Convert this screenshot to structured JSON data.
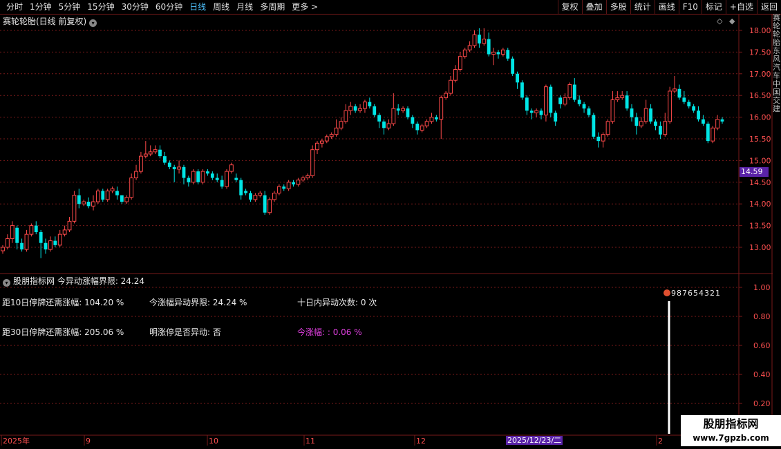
{
  "toolbar": {
    "periods": [
      "分时",
      "1分钟",
      "5分钟",
      "15分钟",
      "30分钟",
      "60分钟",
      "日线",
      "周线",
      "月线",
      "多周期",
      "更多 >"
    ],
    "active_period": "日线",
    "actions": [
      "复权",
      "叠加",
      "多股",
      "统计",
      "画线",
      "F10",
      "标记",
      "+自选",
      "返回"
    ]
  },
  "chart_title": "赛轮轮胎(日线 前复权)",
  "current_price_tag": "14.59",
  "y_axis_ticks": [
    "18.00",
    "17.50",
    "17.00",
    "16.50",
    "16.00",
    "15.50",
    "15.00",
    "14.50",
    "14.00",
    "13.50",
    "13.00"
  ],
  "indicator": {
    "title": "股朋指标网 今异动涨幅界限: 24.24",
    "row1": [
      "距10日停牌还需涨幅: 104.20 %",
      "今涨幅异动界限: 24.24 %",
      "十日内异动次数: 0 次"
    ],
    "row2": [
      "距30日停牌还需涨幅: 205.06 %",
      "明涨停是否异动: 否",
      "今涨幅: : 0.06 %"
    ],
    "y_ticks": [
      "1.00",
      "0.80",
      "0.60",
      "0.40",
      "0.20"
    ],
    "marker_digits": "987654321"
  },
  "x_axis": {
    "labels": [
      "2025年",
      "9",
      "10",
      "11",
      "12",
      "2"
    ],
    "highlight_date": "2025/12/23/二"
  },
  "watermark": {
    "line1": "股朋指标网",
    "line2": "www.7gpzb.com"
  },
  "right_strip_text": "赛轮轮胎东风汽车中国交建",
  "colors": {
    "up": "#ff4a4a",
    "down": "#00e5e5",
    "grid": "#7a1a1a",
    "accent_purple": "#5a23a8",
    "indicator_magenta": "#e040e0"
  },
  "chart_data": {
    "type": "candlestick",
    "ylim": [
      12.4,
      18.15
    ],
    "candles": [
      [
        12.92,
        13.0,
        12.85,
        13.05
      ],
      [
        13.0,
        13.2,
        12.95,
        13.3
      ],
      [
        13.2,
        13.5,
        13.1,
        13.6
      ],
      [
        13.45,
        13.1,
        12.95,
        13.5
      ],
      [
        13.1,
        12.95,
        12.9,
        13.2
      ],
      [
        12.95,
        13.3,
        12.9,
        13.4
      ],
      [
        13.3,
        13.5,
        13.25,
        13.55
      ],
      [
        13.5,
        13.35,
        13.3,
        13.6
      ],
      [
        13.35,
        13.1,
        12.75,
        13.4
      ],
      [
        13.1,
        12.95,
        12.85,
        13.2
      ],
      [
        12.95,
        13.15,
        12.9,
        13.25
      ],
      [
        13.15,
        13.05,
        13.0,
        13.25
      ],
      [
        13.05,
        13.3,
        13.0,
        13.4
      ],
      [
        13.3,
        13.4,
        13.25,
        13.5
      ],
      [
        13.4,
        13.6,
        13.35,
        13.7
      ],
      [
        13.6,
        14.2,
        13.55,
        14.3
      ],
      [
        14.2,
        14.0,
        13.9,
        14.35
      ],
      [
        14.0,
        14.05,
        13.95,
        14.1
      ],
      [
        14.05,
        13.95,
        13.9,
        14.15
      ],
      [
        13.95,
        14.05,
        13.85,
        14.2
      ],
      [
        14.05,
        14.3,
        14.0,
        14.35
      ],
      [
        14.3,
        14.1,
        14.05,
        14.35
      ],
      [
        14.1,
        14.3,
        14.05,
        14.35
      ],
      [
        14.3,
        14.35,
        14.25,
        14.4
      ],
      [
        14.3,
        14.2,
        14.1,
        14.4
      ],
      [
        14.2,
        14.05,
        14.0,
        14.2
      ],
      [
        14.05,
        14.15,
        14.0,
        14.2
      ],
      [
        14.15,
        14.6,
        14.1,
        14.7
      ],
      [
        14.6,
        14.75,
        14.55,
        14.9
      ],
      [
        14.75,
        15.1,
        14.7,
        15.2
      ],
      [
        15.1,
        15.15,
        15.05,
        15.45
      ],
      [
        15.15,
        15.2,
        15.1,
        15.35
      ],
      [
        15.2,
        15.25,
        15.15,
        15.35
      ],
      [
        15.25,
        15.1,
        15.05,
        15.35
      ],
      [
        15.1,
        14.95,
        14.9,
        15.2
      ],
      [
        14.95,
        14.85,
        14.8,
        15.0
      ],
      [
        14.85,
        14.8,
        14.5,
        14.9
      ],
      [
        14.8,
        14.85,
        14.7,
        15.0
      ],
      [
        14.85,
        14.6,
        14.45,
        14.9
      ],
      [
        14.6,
        14.5,
        14.4,
        14.65
      ],
      [
        14.5,
        14.75,
        14.45,
        14.8
      ],
      [
        14.75,
        14.5,
        14.45,
        14.8
      ],
      [
        14.5,
        14.75,
        14.45,
        14.8
      ],
      [
        14.75,
        14.7,
        14.65,
        14.8
      ],
      [
        14.7,
        14.6,
        14.55,
        14.75
      ],
      [
        14.6,
        14.55,
        14.5,
        14.7
      ],
      [
        14.55,
        14.4,
        14.35,
        14.65
      ],
      [
        14.4,
        14.75,
        14.35,
        14.8
      ],
      [
        14.75,
        14.9,
        14.7,
        14.95
      ],
      [
        14.6,
        14.55,
        14.5,
        14.7
      ],
      [
        14.55,
        14.2,
        14.1,
        14.6
      ],
      [
        14.3,
        14.25,
        14.2,
        14.35
      ],
      [
        14.25,
        14.1,
        14.05,
        14.3
      ],
      [
        14.1,
        14.2,
        14.05,
        14.25
      ],
      [
        14.2,
        14.25,
        14.15,
        14.3
      ],
      [
        14.2,
        13.8,
        13.75,
        14.3
      ],
      [
        13.8,
        14.1,
        13.75,
        14.15
      ],
      [
        14.1,
        14.25,
        14.05,
        14.3
      ],
      [
        14.25,
        14.4,
        14.2,
        14.45
      ],
      [
        14.4,
        14.35,
        14.3,
        14.45
      ],
      [
        14.35,
        14.5,
        14.3,
        14.55
      ],
      [
        14.5,
        14.45,
        14.4,
        14.55
      ],
      [
        14.45,
        14.55,
        14.4,
        14.6
      ],
      [
        14.55,
        14.6,
        14.5,
        14.65
      ],
      [
        14.6,
        14.65,
        14.55,
        14.7
      ],
      [
        14.65,
        15.25,
        14.6,
        15.35
      ],
      [
        15.25,
        15.4,
        15.15,
        15.45
      ],
      [
        15.4,
        15.45,
        15.3,
        15.5
      ],
      [
        15.45,
        15.55,
        15.4,
        15.6
      ],
      [
        15.55,
        15.6,
        15.5,
        15.65
      ],
      [
        15.6,
        15.75,
        15.55,
        15.95
      ],
      [
        15.75,
        15.9,
        15.7,
        16.0
      ],
      [
        15.9,
        16.15,
        15.85,
        16.3
      ],
      [
        16.15,
        16.25,
        16.05,
        16.35
      ],
      [
        16.25,
        16.15,
        16.1,
        16.3
      ],
      [
        16.15,
        16.2,
        16.1,
        16.3
      ],
      [
        16.2,
        16.35,
        16.1,
        16.4
      ],
      [
        16.35,
        16.25,
        16.2,
        16.45
      ],
      [
        16.25,
        16.05,
        16.0,
        16.3
      ],
      [
        16.05,
        15.9,
        15.75,
        16.1
      ],
      [
        15.9,
        15.75,
        15.6,
        15.95
      ],
      [
        15.75,
        15.85,
        15.7,
        15.95
      ],
      [
        15.85,
        16.2,
        15.8,
        16.55
      ],
      [
        16.2,
        16.15,
        16.05,
        16.3
      ],
      [
        16.15,
        16.2,
        16.1,
        16.25
      ],
      [
        16.2,
        16.0,
        15.95,
        16.25
      ],
      [
        16.0,
        15.85,
        15.75,
        16.05
      ],
      [
        15.85,
        15.7,
        15.6,
        15.9
      ],
      [
        15.7,
        15.8,
        15.65,
        15.85
      ],
      [
        15.8,
        15.9,
        15.75,
        15.95
      ],
      [
        15.9,
        16.0,
        15.85,
        16.1
      ],
      [
        16.0,
        15.95,
        15.9,
        16.05
      ],
      [
        15.95,
        16.45,
        15.5,
        16.5
      ],
      [
        16.45,
        16.55,
        16.4,
        16.6
      ],
      [
        16.55,
        16.85,
        16.5,
        16.95
      ],
      [
        16.85,
        17.1,
        16.8,
        17.2
      ],
      [
        17.1,
        17.4,
        17.05,
        17.5
      ],
      [
        17.4,
        17.55,
        17.35,
        17.6
      ],
      [
        17.55,
        17.65,
        17.5,
        17.75
      ],
      [
        17.65,
        17.9,
        17.6,
        18.0
      ],
      [
        17.9,
        17.7,
        17.6,
        18.05
      ],
      [
        17.7,
        17.8,
        17.65,
        18.05
      ],
      [
        17.8,
        17.45,
        17.4,
        17.95
      ],
      [
        17.45,
        17.5,
        17.2,
        17.6
      ],
      [
        17.5,
        17.45,
        17.35,
        17.55
      ],
      [
        17.45,
        17.55,
        17.4,
        17.6
      ],
      [
        17.55,
        17.35,
        17.3,
        17.6
      ],
      [
        17.35,
        17.0,
        16.95,
        17.4
      ],
      [
        17.0,
        16.8,
        16.65,
        17.05
      ],
      [
        16.8,
        16.45,
        16.4,
        16.85
      ],
      [
        16.45,
        16.15,
        16.05,
        16.5
      ],
      [
        16.15,
        16.1,
        15.95,
        16.2
      ],
      [
        16.1,
        16.15,
        16.0,
        16.2
      ],
      [
        16.15,
        16.05,
        15.95,
        16.2
      ],
      [
        16.05,
        16.7,
        15.9,
        16.75
      ],
      [
        16.7,
        16.1,
        16.0,
        16.75
      ],
      [
        16.1,
        15.9,
        15.8,
        16.15
      ],
      [
        16.45,
        16.3,
        16.2,
        16.5
      ],
      [
        16.3,
        16.45,
        16.25,
        16.55
      ],
      [
        16.45,
        16.75,
        16.4,
        16.8
      ],
      [
        16.75,
        16.4,
        16.35,
        16.9
      ],
      [
        16.4,
        16.3,
        16.25,
        16.5
      ],
      [
        16.3,
        16.2,
        16.1,
        16.35
      ],
      [
        16.2,
        16.05,
        16.0,
        16.25
      ],
      [
        16.05,
        15.55,
        15.5,
        16.1
      ],
      [
        15.55,
        15.45,
        15.3,
        15.65
      ],
      [
        15.45,
        15.6,
        15.3,
        15.65
      ],
      [
        15.6,
        15.9,
        15.55,
        15.95
      ],
      [
        15.9,
        16.4,
        15.85,
        16.6
      ],
      [
        16.4,
        16.45,
        16.35,
        16.6
      ],
      [
        16.45,
        16.5,
        16.4,
        16.6
      ],
      [
        16.5,
        16.2,
        16.15,
        16.6
      ],
      [
        16.2,
        16.0,
        15.9,
        16.3
      ],
      [
        16.0,
        15.8,
        15.6,
        16.1
      ],
      [
        15.8,
        15.9,
        15.75,
        16.0
      ],
      [
        15.9,
        16.2,
        15.85,
        16.4
      ],
      [
        16.2,
        15.9,
        15.85,
        16.3
      ],
      [
        15.9,
        15.8,
        15.7,
        15.95
      ],
      [
        15.8,
        15.6,
        15.5,
        15.9
      ],
      [
        15.6,
        15.9,
        15.55,
        16.1
      ],
      [
        15.9,
        16.6,
        15.85,
        16.7
      ],
      [
        16.6,
        16.65,
        16.55,
        16.95
      ],
      [
        16.65,
        16.45,
        16.4,
        16.75
      ],
      [
        16.45,
        16.35,
        16.3,
        16.6
      ],
      [
        16.35,
        16.25,
        16.2,
        16.4
      ],
      [
        16.25,
        16.15,
        16.1,
        16.3
      ],
      [
        16.15,
        15.95,
        15.9,
        16.25
      ],
      [
        15.95,
        15.85,
        15.8,
        16.05
      ],
      [
        15.85,
        15.45,
        15.4,
        15.9
      ],
      [
        15.45,
        15.75,
        15.4,
        15.8
      ],
      [
        15.75,
        15.95,
        15.7,
        16.05
      ],
      [
        15.95,
        15.9,
        15.85,
        16.0
      ]
    ],
    "indicator_ylim": [
      0,
      1.0
    ]
  }
}
